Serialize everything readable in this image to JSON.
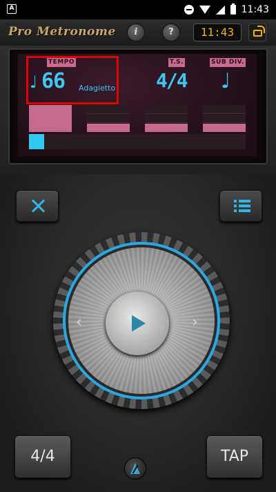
{
  "status_bar": {
    "left_icon": "A",
    "time": "11:43",
    "icons": [
      "do-not-disturb-icon",
      "wifi-icon",
      "signal-icon",
      "battery-icon"
    ]
  },
  "header": {
    "logo": "Pro Metronome",
    "info_label": "i",
    "help_label": "?",
    "clock": "11:43",
    "rotate_icon": "screen-rotate-icon"
  },
  "display": {
    "tempo_label": "TEMPO",
    "tempo_value": "66",
    "tempo_name": "Adagietto",
    "note_symbol": "♩",
    "ts_label": "T.S.",
    "ts_value": "4/4",
    "subdiv_label": "SUB DIV.",
    "subdiv_symbol": "♩",
    "beats": [
      {
        "level": "accent"
      },
      {
        "level": "normal"
      },
      {
        "level": "normal"
      },
      {
        "level": "normal"
      }
    ],
    "progress_fraction": 0.07
  },
  "controls": {
    "tools_icon": "tools-icon",
    "list_icon": "list-icon",
    "dial_left": "‹",
    "dial_right": "›",
    "play_icon": "play-icon",
    "ts_button": "4/4",
    "tap_button": "TAP",
    "metronome_icon": "metronome-icon"
  },
  "colors": {
    "accent_cyan": "#3ec8f0",
    "label_pink": "#c96a8e",
    "logo_gold": "#c9a86a",
    "clock_amber": "#f4b400"
  }
}
